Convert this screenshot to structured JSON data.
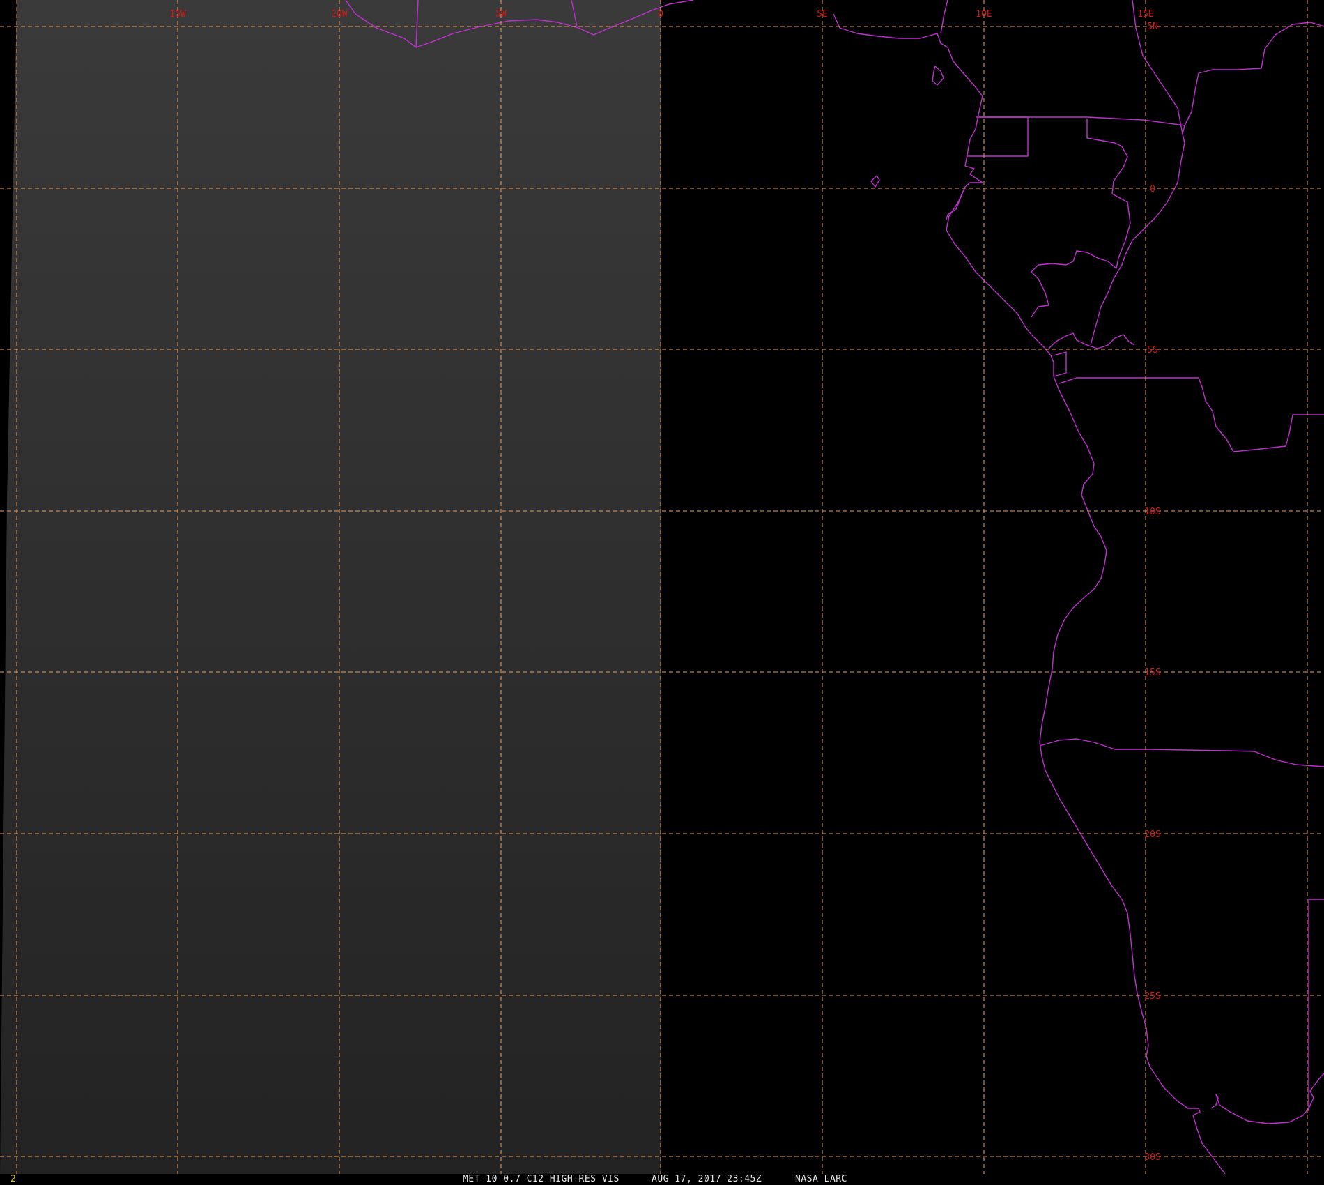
{
  "map": {
    "colors": {
      "background": "#000000",
      "image_panel_top": "#3a3a3a",
      "image_panel_bottom": "#232323",
      "grid": "#e8a060",
      "coastline": "#c030d0",
      "grid_label": "#d01818"
    },
    "longitude_labels": [
      "15W",
      "10W",
      "5W",
      "0",
      "5E",
      "10E",
      "15E"
    ],
    "latitude_labels": [
      "5N",
      "0",
      "5S",
      "10S",
      "15S",
      "20S",
      "25S",
      "30S"
    ]
  },
  "status_bar": {
    "frame_number": "2",
    "product": "MET-10 0.7 C12 HIGH-RES VIS",
    "datetime": "AUG 17, 2017 23:45Z",
    "source": "NASA LARC"
  }
}
